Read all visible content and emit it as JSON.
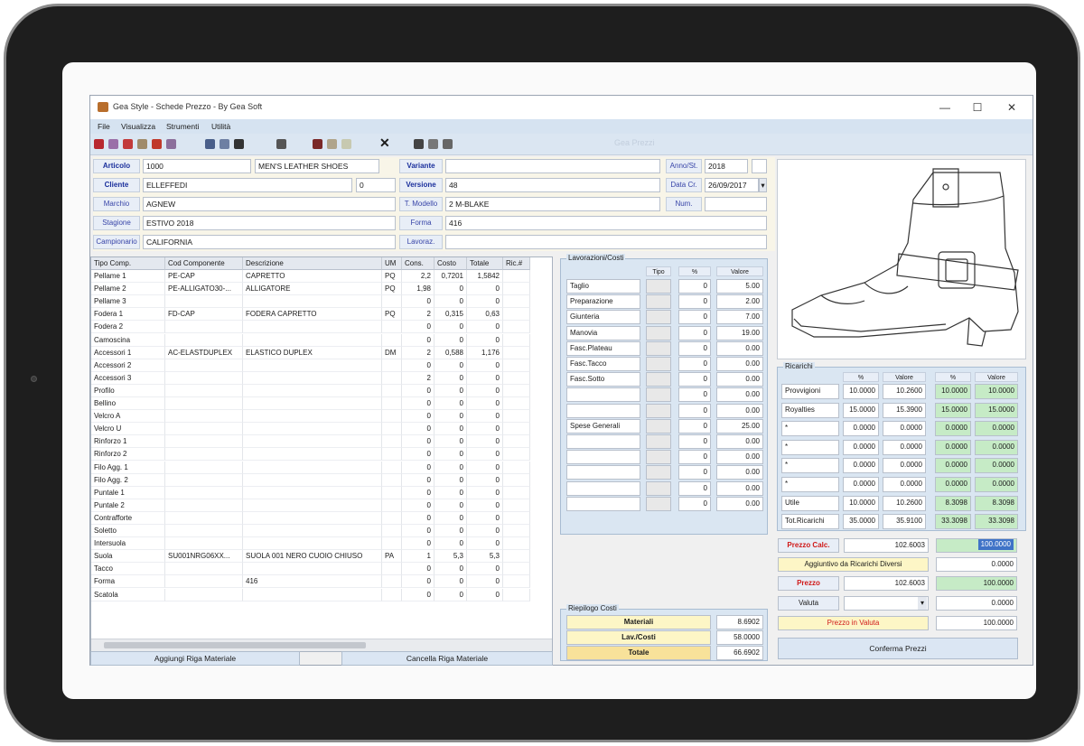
{
  "window": {
    "title": "Gea Style - Schede Prezzo - By Gea Soft",
    "controls": {
      "minimize": "—",
      "maximize": "☐",
      "close": "✕"
    }
  },
  "menu": [
    "File",
    "Visualizza",
    "Strumenti",
    "Utilità"
  ],
  "toolbar": {
    "icons": [
      "new-doc-icon",
      "open-icon",
      "save-icon",
      "copy-icon",
      "print-icon",
      "report-icon",
      "list-view-icon",
      "grid-view-icon",
      "photo-icon",
      "calculator-icon",
      "book-icon",
      "email-icon",
      "export-icon",
      "cancel-icon",
      "move-icon",
      "paste-icon",
      "clone-icon"
    ],
    "cancel_glyph": "✕",
    "faint_text": "Gea Prezzi"
  },
  "header": {
    "articolo": {
      "label": "Articolo",
      "code": "1000",
      "desc": "MEN'S LEATHER SHOES"
    },
    "cliente": {
      "label": "Cliente",
      "value": "ELLEFFEDI",
      "num": "0"
    },
    "marchio": {
      "label": "Marchio",
      "value": "AGNEW"
    },
    "stagione": {
      "label": "Stagione",
      "value": "ESTIVO 2018"
    },
    "campionario": {
      "label": "Campionario",
      "value": "CALIFORNIA"
    },
    "variante": {
      "label": "Variante",
      "value": ""
    },
    "versione": {
      "label": "Versione",
      "value": "48"
    },
    "t_modello": {
      "label": "T. Modello",
      "value": "2 M-BLAKE"
    },
    "forma": {
      "label": "Forma",
      "value": "416"
    },
    "lavoraz": {
      "label": "Lavoraz.",
      "value": ""
    },
    "anno": {
      "label": "Anno/St.",
      "value": "2018"
    },
    "data_cr": {
      "label": "Data Cr.",
      "value": "26/09/2017"
    },
    "num": {
      "label": "Num.",
      "value": ""
    }
  },
  "materials": {
    "columns": [
      "Tipo Comp.",
      "Cod Componente",
      "Descrizione",
      "UM",
      "Cons.",
      "Costo",
      "Totale",
      "Ric.#"
    ],
    "rows": [
      [
        "Pellame 1",
        "PE-CAP",
        "CAPRETTO",
        "PQ",
        "2,2",
        "0,7201",
        "1,5842",
        ""
      ],
      [
        "Pellame 2",
        "PE-ALLIGATO30-...",
        "ALLIGATORE",
        "PQ",
        "1,98",
        "0",
        "0",
        ""
      ],
      [
        "Pellame 3",
        "",
        "",
        "",
        "0",
        "0",
        "0",
        ""
      ],
      [
        "Fodera 1",
        "FD-CAP",
        "FODERA CAPRETTO",
        "PQ",
        "2",
        "0,315",
        "0,63",
        ""
      ],
      [
        "Fodera 2",
        "",
        "",
        "",
        "0",
        "0",
        "0",
        ""
      ],
      [
        "Camoscina",
        "",
        "",
        "",
        "0",
        "0",
        "0",
        ""
      ],
      [
        "Accessori 1",
        "AC-ELASTDUPLEX",
        "ELASTICO DUPLEX",
        "DM",
        "2",
        "0,588",
        "1,176",
        ""
      ],
      [
        "Accessori 2",
        "",
        "",
        "",
        "0",
        "0",
        "0",
        ""
      ],
      [
        "Accessori 3",
        "",
        "",
        "",
        "2",
        "0",
        "0",
        ""
      ],
      [
        "Profilo",
        "",
        "",
        "",
        "0",
        "0",
        "0",
        ""
      ],
      [
        "Bellino",
        "",
        "",
        "",
        "0",
        "0",
        "0",
        ""
      ],
      [
        "Velcro A",
        "",
        "",
        "",
        "0",
        "0",
        "0",
        ""
      ],
      [
        "Velcro U",
        "",
        "",
        "",
        "0",
        "0",
        "0",
        ""
      ],
      [
        "Rinforzo 1",
        "",
        "",
        "",
        "0",
        "0",
        "0",
        ""
      ],
      [
        "Rinforzo 2",
        "",
        "",
        "",
        "0",
        "0",
        "0",
        ""
      ],
      [
        "Filo Agg. 1",
        "",
        "",
        "",
        "0",
        "0",
        "0",
        ""
      ],
      [
        "Filo Agg. 2",
        "",
        "",
        "",
        "0",
        "0",
        "0",
        ""
      ],
      [
        "Puntale 1",
        "",
        "",
        "",
        "0",
        "0",
        "0",
        ""
      ],
      [
        "Puntale 2",
        "",
        "",
        "",
        "0",
        "0",
        "0",
        ""
      ],
      [
        "Contrafforte",
        "",
        "",
        "",
        "0",
        "0",
        "0",
        ""
      ],
      [
        "Soletto",
        "",
        "",
        "",
        "0",
        "0",
        "0",
        ""
      ],
      [
        "Intersuola",
        "",
        "",
        "",
        "0",
        "0",
        "0",
        ""
      ],
      [
        "Suola",
        "SU001NRG06XX...",
        "SUOLA 001 NERO CUOIO CHIUSO",
        "PA",
        "1",
        "5,3",
        "5,3",
        ""
      ],
      [
        "Tacco",
        "",
        "",
        "",
        "0",
        "0",
        "0",
        ""
      ],
      [
        "Forma",
        "",
        "416",
        "",
        "0",
        "0",
        "0",
        ""
      ],
      [
        "Scatola",
        "",
        "",
        "",
        "0",
        "0",
        "0",
        ""
      ]
    ],
    "add_button": "Aggiungi Riga Materiale",
    "delete_button": "Cancella Riga Materiale"
  },
  "lavorazioni": {
    "title": "Lavorazioni/Costi",
    "columns": [
      "Tipo",
      "%",
      "Valore"
    ],
    "rows": [
      {
        "name": "Taglio",
        "pct": "0",
        "value": "5.00"
      },
      {
        "name": "Preparazione",
        "pct": "0",
        "value": "2.00"
      },
      {
        "name": "Giunteria",
        "pct": "0",
        "value": "7.00"
      },
      {
        "name": "Manovia",
        "pct": "0",
        "value": "19.00"
      },
      {
        "name": "Fasc.Plateau",
        "pct": "0",
        "value": "0.00"
      },
      {
        "name": "Fasc.Tacco",
        "pct": "0",
        "value": "0.00"
      },
      {
        "name": "Fasc.Sotto",
        "pct": "0",
        "value": "0.00"
      },
      {
        "name": "",
        "pct": "0",
        "value": "0.00"
      },
      {
        "name": "",
        "pct": "0",
        "value": "0.00"
      },
      {
        "name": "Spese Generali",
        "pct": "0",
        "value": "25.00"
      },
      {
        "name": "",
        "pct": "0",
        "value": "0.00"
      },
      {
        "name": "",
        "pct": "0",
        "value": "0.00"
      },
      {
        "name": "",
        "pct": "0",
        "value": "0.00"
      },
      {
        "name": "",
        "pct": "0",
        "value": "0.00"
      },
      {
        "name": "",
        "pct": "0",
        "value": "0.00"
      }
    ]
  },
  "riepilogo": {
    "title": "Riepilogo Costi",
    "materiali_label": "Materiali",
    "materiali_value": "8.6902",
    "lav_label": "Lav./Costi",
    "lav_value": "58.0000",
    "totale_label": "Totale",
    "totale_value": "66.6902"
  },
  "ricarichi": {
    "title": "Ricarichi",
    "columns": [
      "%",
      "Valore",
      "%",
      "Valore"
    ],
    "rows": [
      {
        "name": "Provvigioni",
        "p1": "10.0000",
        "v1": "10.2600",
        "p2": "10.0000",
        "v2": "10.0000"
      },
      {
        "name": "Royalties",
        "p1": "15.0000",
        "v1": "15.3900",
        "p2": "15.0000",
        "v2": "15.0000"
      },
      {
        "name": "*",
        "p1": "0.0000",
        "v1": "0.0000",
        "p2": "0.0000",
        "v2": "0.0000"
      },
      {
        "name": "*",
        "p1": "0.0000",
        "v1": "0.0000",
        "p2": "0.0000",
        "v2": "0.0000"
      },
      {
        "name": "*",
        "p1": "0.0000",
        "v1": "0.0000",
        "p2": "0.0000",
        "v2": "0.0000"
      },
      {
        "name": "*",
        "p1": "0.0000",
        "v1": "0.0000",
        "p2": "0.0000",
        "v2": "0.0000"
      },
      {
        "name": "Utile",
        "p1": "10.0000",
        "v1": "10.2600",
        "p2": "8.3098",
        "v2": "8.3098"
      },
      {
        "name": "Tot.Ricarichi",
        "p1": "35.0000",
        "v1": "35.9100",
        "p2": "33.3098",
        "v2": "33.3098"
      }
    ]
  },
  "prezzi": {
    "prezzo_calc_label": "Prezzo Calc.",
    "prezzo_calc_value": "102.6003",
    "prezzo_calc_sel": "100.0000",
    "aggiuntivo_label": "Aggiuntivo da Ricarichi Diversi",
    "aggiuntivo_value": "0.0000",
    "prezzo_label": "Prezzo",
    "prezzo_value": "102.6003",
    "prezzo_green": "100.0000",
    "valuta_label": "Valuta",
    "valuta_value": "0.0000",
    "prezzo_valuta_label": "Prezzo in Valuta",
    "prezzo_valuta_value": "100.0000",
    "conferma_button": "Conferma Prezzi",
    "dropdown_glyph": "▾"
  },
  "colors": {
    "accent": "#1a2f9c",
    "calc_red": "#d01818",
    "green_cell": "#c6ebc6",
    "selection": "#3f73c7"
  }
}
